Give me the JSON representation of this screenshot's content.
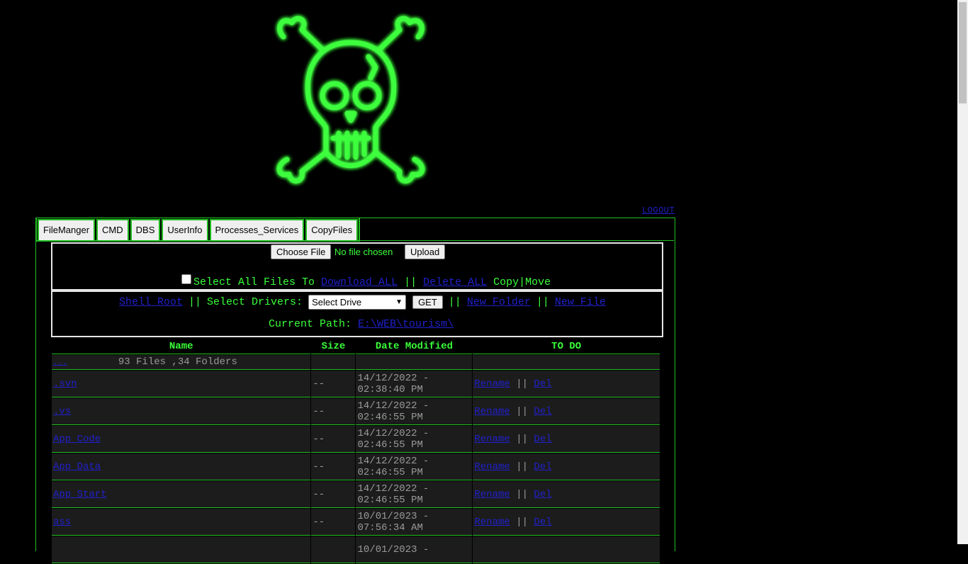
{
  "logout": "LOGOUT",
  "tabs": [
    "FileManger",
    "CMD",
    "DBS",
    "UserInfo",
    "Processes_Services",
    "CopyFiles"
  ],
  "upload": {
    "choose_label": "Choose File",
    "no_file": "No file chosen",
    "upload_label": "Upload"
  },
  "select_row": {
    "select_all": "Select All Files To",
    "download_all": "Download ALL",
    "sep": "||",
    "delete_all": "Delete ALL",
    "copy_move": "Copy|Move"
  },
  "drive_row": {
    "shell_root": "Shell Root",
    "sep": "||",
    "select_drivers": "Select Drivers:",
    "select_drive": "Select Drive",
    "get": "GET",
    "new_folder": "New Folder",
    "new_file": "New File"
  },
  "path_row": {
    "label": "Current Path:",
    "path": "E:\\WEB\\tourism\\"
  },
  "table": {
    "headers": [
      "Name",
      "Size",
      "Date Modified",
      "TO DO"
    ],
    "up_link": "...",
    "summary": "93 Files ,34 Folders",
    "rows": [
      {
        "name": ".svn",
        "size": "--",
        "date": "14/12/2022 -\n02:38:40 PM",
        "rename": "Rename",
        "sep": "||",
        "del": "Del"
      },
      {
        "name": ".vs",
        "size": "--",
        "date": "14/12/2022 -\n02:46:55 PM",
        "rename": "Rename",
        "sep": "||",
        "del": "Del"
      },
      {
        "name": "App_Code",
        "size": "--",
        "date": "14/12/2022 -\n02:46:55 PM",
        "rename": "Rename",
        "sep": "||",
        "del": "Del"
      },
      {
        "name": "App_Data",
        "size": "--",
        "date": "14/12/2022 -\n02:46:55 PM",
        "rename": "Rename",
        "sep": "||",
        "del": "Del"
      },
      {
        "name": "App_Start",
        "size": "--",
        "date": "14/12/2022 -\n02:46:55 PM",
        "rename": "Rename",
        "sep": "||",
        "del": "Del"
      },
      {
        "name": "ass",
        "size": "--",
        "date": "10/01/2023 -\n07:56:34 AM",
        "rename": "Rename",
        "sep": "||",
        "del": "Del"
      },
      {
        "name": "",
        "size": "",
        "date": "10/01/2023 -\n",
        "rename": "",
        "sep": "",
        "del": ""
      }
    ]
  }
}
